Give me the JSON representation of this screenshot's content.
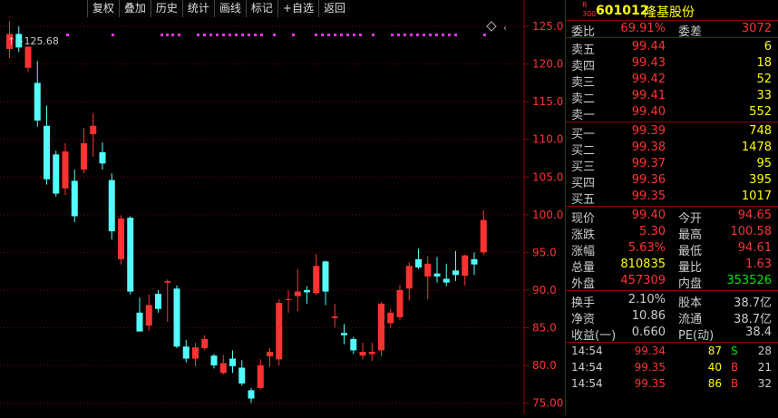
{
  "toolbar": {
    "buttons": [
      "复权",
      "叠加",
      "历史",
      "统计",
      "画线",
      "标记",
      "+自选",
      "返回"
    ]
  },
  "chart": {
    "high_label": "125.68",
    "y_ticks": [
      "125.0",
      "120.0",
      "115.0",
      "110.0",
      "105.0",
      "100.0",
      "95.0",
      "90.0",
      "85.0",
      "80.0",
      "75.00"
    ]
  },
  "chart_data": {
    "type": "candlestick",
    "ylim": [
      73.5,
      128.5
    ],
    "y_ticks": [
      125,
      120,
      115,
      110,
      105,
      100,
      95,
      90,
      85,
      80,
      75
    ],
    "up_color": "#ff3232",
    "down_color": "#54fcfc",
    "candles": [
      {
        "o": 122.0,
        "c": 124.0,
        "h": 125.68,
        "l": 120.8
      },
      {
        "o": 124.0,
        "c": 122.2,
        "h": 125.0,
        "l": 121.6
      },
      {
        "o": 119.5,
        "c": 122.3,
        "h": 122.4,
        "l": 119.0
      },
      {
        "o": 117.5,
        "c": 112.5,
        "h": 120.4,
        "l": 111.7
      },
      {
        "o": 111.8,
        "c": 104.7,
        "h": 114.5,
        "l": 104.0
      },
      {
        "o": 108.0,
        "c": 102.8,
        "h": 108.5,
        "l": 102.4
      },
      {
        "o": 103.5,
        "c": 108.4,
        "h": 109.5,
        "l": 102.6
      },
      {
        "o": 104.5,
        "c": 99.8,
        "h": 106.0,
        "l": 99.0
      },
      {
        "o": 106.0,
        "c": 109.5,
        "h": 111.5,
        "l": 105.5
      },
      {
        "o": 110.7,
        "c": 111.8,
        "h": 113.5,
        "l": 107.7
      },
      {
        "o": 108.3,
        "c": 106.8,
        "h": 109.6,
        "l": 106.0
      },
      {
        "o": 104.6,
        "c": 97.8,
        "h": 105.5,
        "l": 96.7
      },
      {
        "o": 94.1,
        "c": 99.5,
        "h": 99.9,
        "l": 93.4
      },
      {
        "o": 99.6,
        "c": 89.8,
        "h": 99.8,
        "l": 89.4
      },
      {
        "o": 87.0,
        "c": 84.5,
        "h": 89.0,
        "l": 84.5
      },
      {
        "o": 85.3,
        "c": 88.0,
        "h": 89.4,
        "l": 84.6
      },
      {
        "o": 89.5,
        "c": 87.5,
        "h": 90.0,
        "l": 87.0
      },
      {
        "o": 91.0,
        "c": 91.2,
        "h": 91.4,
        "l": 85.8
      },
      {
        "o": 90.2,
        "c": 82.5,
        "h": 90.6,
        "l": 82.3
      },
      {
        "o": 82.5,
        "c": 80.9,
        "h": 83.4,
        "l": 80.4
      },
      {
        "o": 80.9,
        "c": 82.4,
        "h": 83.0,
        "l": 79.9
      },
      {
        "o": 82.3,
        "c": 83.5,
        "h": 84.0,
        "l": 82.0
      },
      {
        "o": 81.3,
        "c": 80.0,
        "h": 81.5,
        "l": 79.6
      },
      {
        "o": 79.0,
        "c": 80.3,
        "h": 81.4,
        "l": 78.8
      },
      {
        "o": 80.9,
        "c": 79.9,
        "h": 82.0,
        "l": 79.0
      },
      {
        "o": 79.7,
        "c": 77.6,
        "h": 80.7,
        "l": 77.3
      },
      {
        "o": 76.7,
        "c": 75.6,
        "h": 77.0,
        "l": 75.0
      },
      {
        "o": 77.0,
        "c": 80.0,
        "h": 80.8,
        "l": 76.8
      },
      {
        "o": 81.2,
        "c": 81.8,
        "h": 82.3,
        "l": 79.8
      },
      {
        "o": 80.8,
        "c": 88.3,
        "h": 88.8,
        "l": 80.0
      },
      {
        "o": 88.8,
        "c": 88.8,
        "h": 90.0,
        "l": 87.0
      },
      {
        "o": 89.2,
        "c": 89.8,
        "h": 92.8,
        "l": 87.2
      },
      {
        "o": 90.0,
        "c": 89.7,
        "h": 90.5,
        "l": 88.2
      },
      {
        "o": 89.6,
        "c": 93.2,
        "h": 94.8,
        "l": 89.3
      },
      {
        "o": 93.8,
        "c": 89.8,
        "h": 93.9,
        "l": 88.0
      },
      {
        "o": 86.3,
        "c": 86.5,
        "h": 88.2,
        "l": 85.0
      },
      {
        "o": 84.3,
        "c": 84.0,
        "h": 85.5,
        "l": 82.8
      },
      {
        "o": 83.5,
        "c": 82.0,
        "h": 83.8,
        "l": 81.5
      },
      {
        "o": 81.3,
        "c": 81.8,
        "h": 83.0,
        "l": 80.8
      },
      {
        "o": 81.5,
        "c": 81.8,
        "h": 83.0,
        "l": 80.6
      },
      {
        "o": 82.0,
        "c": 88.2,
        "h": 88.4,
        "l": 81.2
      },
      {
        "o": 85.6,
        "c": 87.0,
        "h": 87.5,
        "l": 85.0
      },
      {
        "o": 86.4,
        "c": 90.0,
        "h": 90.7,
        "l": 86.0
      },
      {
        "o": 90.2,
        "c": 93.2,
        "h": 93.7,
        "l": 88.6
      },
      {
        "o": 94.1,
        "c": 93.0,
        "h": 95.5,
        "l": 92.8
      },
      {
        "o": 91.8,
        "c": 93.5,
        "h": 94.5,
        "l": 88.8
      },
      {
        "o": 92.2,
        "c": 91.8,
        "h": 94.4,
        "l": 91.0
      },
      {
        "o": 91.5,
        "c": 91.0,
        "h": 93.5,
        "l": 90.5
      },
      {
        "o": 92.6,
        "c": 92.0,
        "h": 95.2,
        "l": 91.2
      },
      {
        "o": 91.9,
        "c": 94.6,
        "h": 94.7,
        "l": 90.6
      },
      {
        "o": 94.1,
        "c": 93.4,
        "h": 95.0,
        "l": 92.0
      },
      {
        "o": 95.0,
        "c": 99.3,
        "h": 100.58,
        "l": 94.61
      }
    ]
  },
  "stock": {
    "badge_r": "R",
    "badge_num": "300",
    "code": "601012",
    "name": "隆基股份"
  },
  "committee": {
    "ratio_label": "委比",
    "ratio_value": "69.91%",
    "diff_label": "委差",
    "diff_value": "3072"
  },
  "sell_orders": [
    {
      "label": "卖五",
      "price": "99.44",
      "volume": "6"
    },
    {
      "label": "卖四",
      "price": "99.43",
      "volume": "18"
    },
    {
      "label": "卖三",
      "price": "99.42",
      "volume": "52"
    },
    {
      "label": "卖二",
      "price": "99.41",
      "volume": "33"
    },
    {
      "label": "卖一",
      "price": "99.40",
      "volume": "552"
    }
  ],
  "buy_orders": [
    {
      "label": "买一",
      "price": "99.39",
      "volume": "748"
    },
    {
      "label": "买二",
      "price": "99.38",
      "volume": "1478"
    },
    {
      "label": "买三",
      "price": "99.37",
      "volume": "95"
    },
    {
      "label": "买四",
      "price": "99.36",
      "volume": "395"
    },
    {
      "label": "买五",
      "price": "99.35",
      "volume": "1017"
    }
  ],
  "quote": [
    {
      "l1": "现价",
      "v1": "99.40",
      "c1": "red",
      "l2": "今开",
      "v2": "94.65",
      "c2": "red"
    },
    {
      "l1": "涨跌",
      "v1": "5.30",
      "c1": "red",
      "l2": "最高",
      "v2": "100.58",
      "c2": "red"
    },
    {
      "l1": "涨幅",
      "v1": "5.63%",
      "c1": "red",
      "l2": "最低",
      "v2": "94.61",
      "c2": "red"
    },
    {
      "l1": "总量",
      "v1": "810835",
      "c1": "yellow",
      "l2": "量比",
      "v2": "1.63",
      "c2": "red"
    },
    {
      "l1": "外盘",
      "v1": "457309",
      "c1": "red",
      "l2": "内盘",
      "v2": "353526",
      "c2": "green"
    }
  ],
  "finance": [
    {
      "l1": "换手",
      "v1": "2.10%",
      "l2": "股本",
      "v2": "38.7亿"
    },
    {
      "l1": "净资",
      "v1": "10.86",
      "l2": "流通",
      "v2": "38.7亿"
    },
    {
      "l1": "收益(一)",
      "v1": "0.660",
      "l2": "PE(动)",
      "v2": "38.4"
    }
  ],
  "trades": [
    {
      "time": "14:54",
      "price": "99.34",
      "volume": "87",
      "side": "S",
      "count": "28"
    },
    {
      "time": "14:54",
      "price": "99.35",
      "volume": "40",
      "side": "B",
      "count": "21"
    },
    {
      "time": "14:54",
      "price": "99.35",
      "volume": "86",
      "side": "B",
      "count": "32"
    }
  ]
}
